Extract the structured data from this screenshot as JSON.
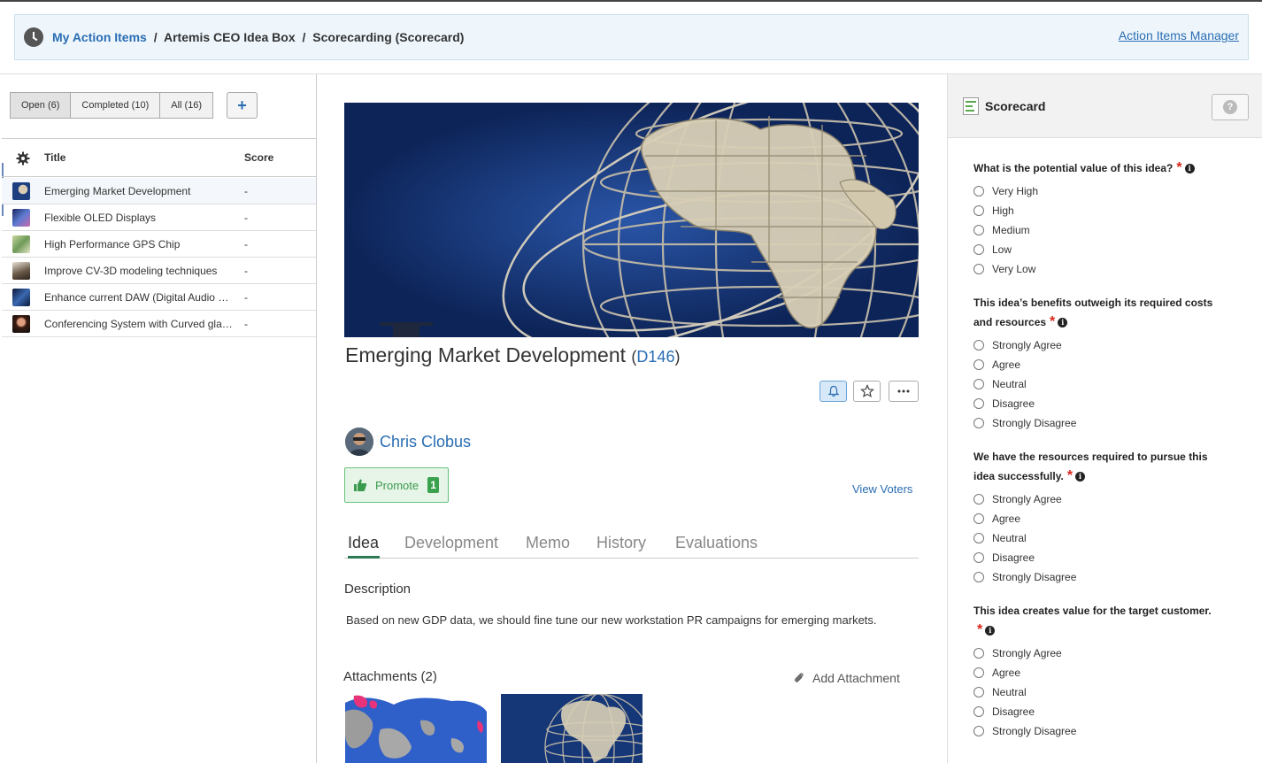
{
  "breadcrumb": {
    "root": "My Action Items",
    "sep": "/",
    "middle": "Artemis CEO Idea Box",
    "current": "Scorecarding (Scorecard)",
    "manager_link": "Action Items Manager"
  },
  "list": {
    "filters": [
      {
        "label": "Open (6)"
      },
      {
        "label": "Completed (10)"
      },
      {
        "label": "All (16)"
      }
    ],
    "add_label": "+",
    "col_title": "Title",
    "col_score": "Score",
    "rows": [
      {
        "title": "Emerging Market Development",
        "score": "-",
        "color": "#1d3f80"
      },
      {
        "title": "Flexible OLED Displays",
        "score": "-",
        "color": "#3a4f9a"
      },
      {
        "title": "High Performance GPS Chip",
        "score": "-",
        "color": "#7c9a5a"
      },
      {
        "title": "Improve CV-3D modeling techniques",
        "score": "-",
        "color": "#6a5a48"
      },
      {
        "title": "Enhance current DAW (Digital Audio Workstation)",
        "score": "-",
        "color": "#26406e"
      },
      {
        "title": "Conferencing System with Curved glass display",
        "score": "-",
        "color": "#8a3a2a"
      }
    ]
  },
  "idea": {
    "title": "Emerging Market Development",
    "code": "D146",
    "paren_open": "(",
    "paren_close": ")",
    "author": "Chris Clobus",
    "promote_label": "Promote",
    "promote_count": "1",
    "view_voters": "View Voters",
    "tabs": [
      {
        "label": "Idea"
      },
      {
        "label": "Development"
      },
      {
        "label": "Memo"
      },
      {
        "label": "History"
      },
      {
        "label": "Evaluations"
      }
    ],
    "description_heading": "Description",
    "description": "Based on new GDP data, we should fine tune our new workstation PR campaigns for emerging markets.",
    "attachments_heading": "Attachments (2)",
    "add_attachment": "Add Attachment"
  },
  "scorecard": {
    "title": "Scorecard",
    "help": "?",
    "questions": [
      {
        "text": "What is the potential value of this idea?",
        "options": [
          "Very High",
          "High",
          "Medium",
          "Low",
          "Very Low"
        ]
      },
      {
        "text": "This idea’s benefits outweigh its required costs and resources",
        "options": [
          "Strongly Agree",
          "Agree",
          "Neutral",
          "Disagree",
          "Strongly Disagree"
        ]
      },
      {
        "text": "We have the resources required to pursue this idea successfully.",
        "options": [
          "Strongly Agree",
          "Agree",
          "Neutral",
          "Disagree",
          "Strongly Disagree"
        ]
      },
      {
        "text": "This idea creates value for the target customer.",
        "options": [
          "Strongly Agree",
          "Agree",
          "Neutral",
          "Disagree",
          "Strongly Disagree"
        ]
      }
    ],
    "required_mark": "*",
    "info_mark": "i"
  }
}
